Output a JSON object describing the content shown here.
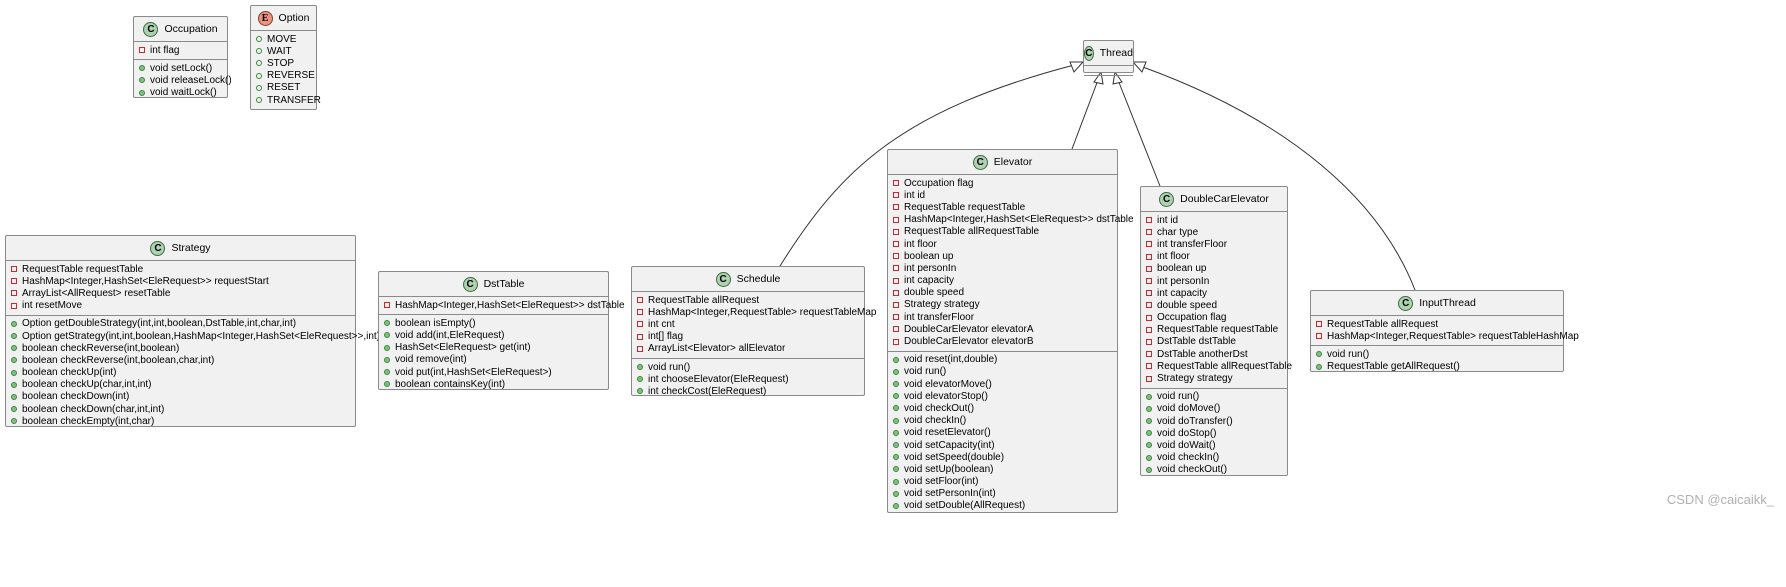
{
  "diagram": {
    "classes": [
      {
        "name": "Occupation",
        "kind": "C",
        "attributes": [
          "int flag"
        ],
        "methods": [
          "void setLock()",
          "void releaseLock()",
          "void waitLock()"
        ]
      },
      {
        "name": "Option",
        "kind": "E",
        "values": [
          "MOVE",
          "WAIT",
          "STOP",
          "REVERSE",
          "RESET",
          "TRANSFER"
        ]
      },
      {
        "name": "Thread",
        "kind": "C",
        "attributes": [],
        "methods": []
      },
      {
        "name": "Strategy",
        "kind": "C",
        "attributes": [
          "RequestTable requestTable",
          "HashMap<Integer,HashSet<EleRequest>> requestStart",
          "ArrayList<AllRequest> resetTable",
          "int resetMove"
        ],
        "methods": [
          "Option getDoubleStrategy(int,int,boolean,DstTable,int,char,int)",
          "Option getStrategy(int,int,boolean,HashMap<Integer,HashSet<EleRequest>>,int)",
          "boolean checkReverse(int,boolean)",
          "boolean checkReverse(int,boolean,char,int)",
          "boolean checkUp(int)",
          "boolean checkUp(char,int,int)",
          "boolean checkDown(int)",
          "boolean checkDown(char,int,int)",
          "boolean checkEmpty(int,char)"
        ]
      },
      {
        "name": "DstTable",
        "kind": "C",
        "attributes": [
          "HashMap<Integer,HashSet<EleRequest>> dstTable"
        ],
        "methods": [
          "boolean isEmpty()",
          "void add(int,EleRequest)",
          "HashSet<EleRequest> get(int)",
          "void remove(int)",
          "void put(int,HashSet<EleRequest>)",
          "boolean containsKey(int)"
        ]
      },
      {
        "name": "Schedule",
        "kind": "C",
        "attributes": [
          "RequestTable allRequest",
          "HashMap<Integer,RequestTable> requestTableMap",
          "int cnt",
          "int[] flag",
          "ArrayList<Elevator> allElevator"
        ],
        "methods": [
          "void run()",
          "int chooseElevator(EleRequest)",
          "int checkCost(EleRequest)"
        ]
      },
      {
        "name": "Elevator",
        "kind": "C",
        "attributes": [
          "Occupation flag",
          "int id",
          "RequestTable requestTable",
          "HashMap<Integer,HashSet<EleRequest>> dstTable",
          "RequestTable allRequestTable",
          "int floor",
          "boolean up",
          "int personIn",
          "int capacity",
          "double speed",
          "Strategy strategy",
          "int transferFloor",
          "DoubleCarElevator elevatorA",
          "DoubleCarElevator elevatorB"
        ],
        "methods": [
          "void reset(int,double)",
          "void run()",
          "void elevatorMove()",
          "void elevatorStop()",
          "void checkOut()",
          "void checkIn()",
          "void resetElevator()",
          "void setCapacity(int)",
          "void setSpeed(double)",
          "void setUp(boolean)",
          "void setFloor(int)",
          "void setPersonIn(int)",
          "void setDouble(AllRequest)"
        ]
      },
      {
        "name": "DoubleCarElevator",
        "kind": "C",
        "attributes": [
          "int id",
          "char type",
          "int transferFloor",
          "int floor",
          "boolean up",
          "int personIn",
          "int capacity",
          "double speed",
          "Occupation flag",
          "RequestTable requestTable",
          "DstTable dstTable",
          "DstTable anotherDst",
          "RequestTable allRequestTable",
          "Strategy strategy"
        ],
        "methods": [
          "void run()",
          "void doMove()",
          "void doTransfer()",
          "void doStop()",
          "void doWait()",
          "void checkIn()",
          "void checkOut()"
        ]
      },
      {
        "name": "InputThread",
        "kind": "C",
        "attributes": [
          "RequestTable allRequest",
          "HashMap<Integer,RequestTable> requestTableHashMap"
        ],
        "methods": [
          "void run()",
          "RequestTable getAllRequest()"
        ]
      }
    ],
    "inheritance": [
      {
        "child": "Schedule",
        "parent": "Thread"
      },
      {
        "child": "Elevator",
        "parent": "Thread"
      },
      {
        "child": "DoubleCarElevator",
        "parent": "Thread"
      },
      {
        "child": "InputThread",
        "parent": "Thread"
      }
    ]
  },
  "watermark": "CSDN @caicaikk_",
  "colors": {
    "box_fill": "#f1f1f1",
    "class_badge": "#add1b2",
    "enum_badge": "#eb937f",
    "private": "#c82930",
    "public": "#84be84"
  }
}
